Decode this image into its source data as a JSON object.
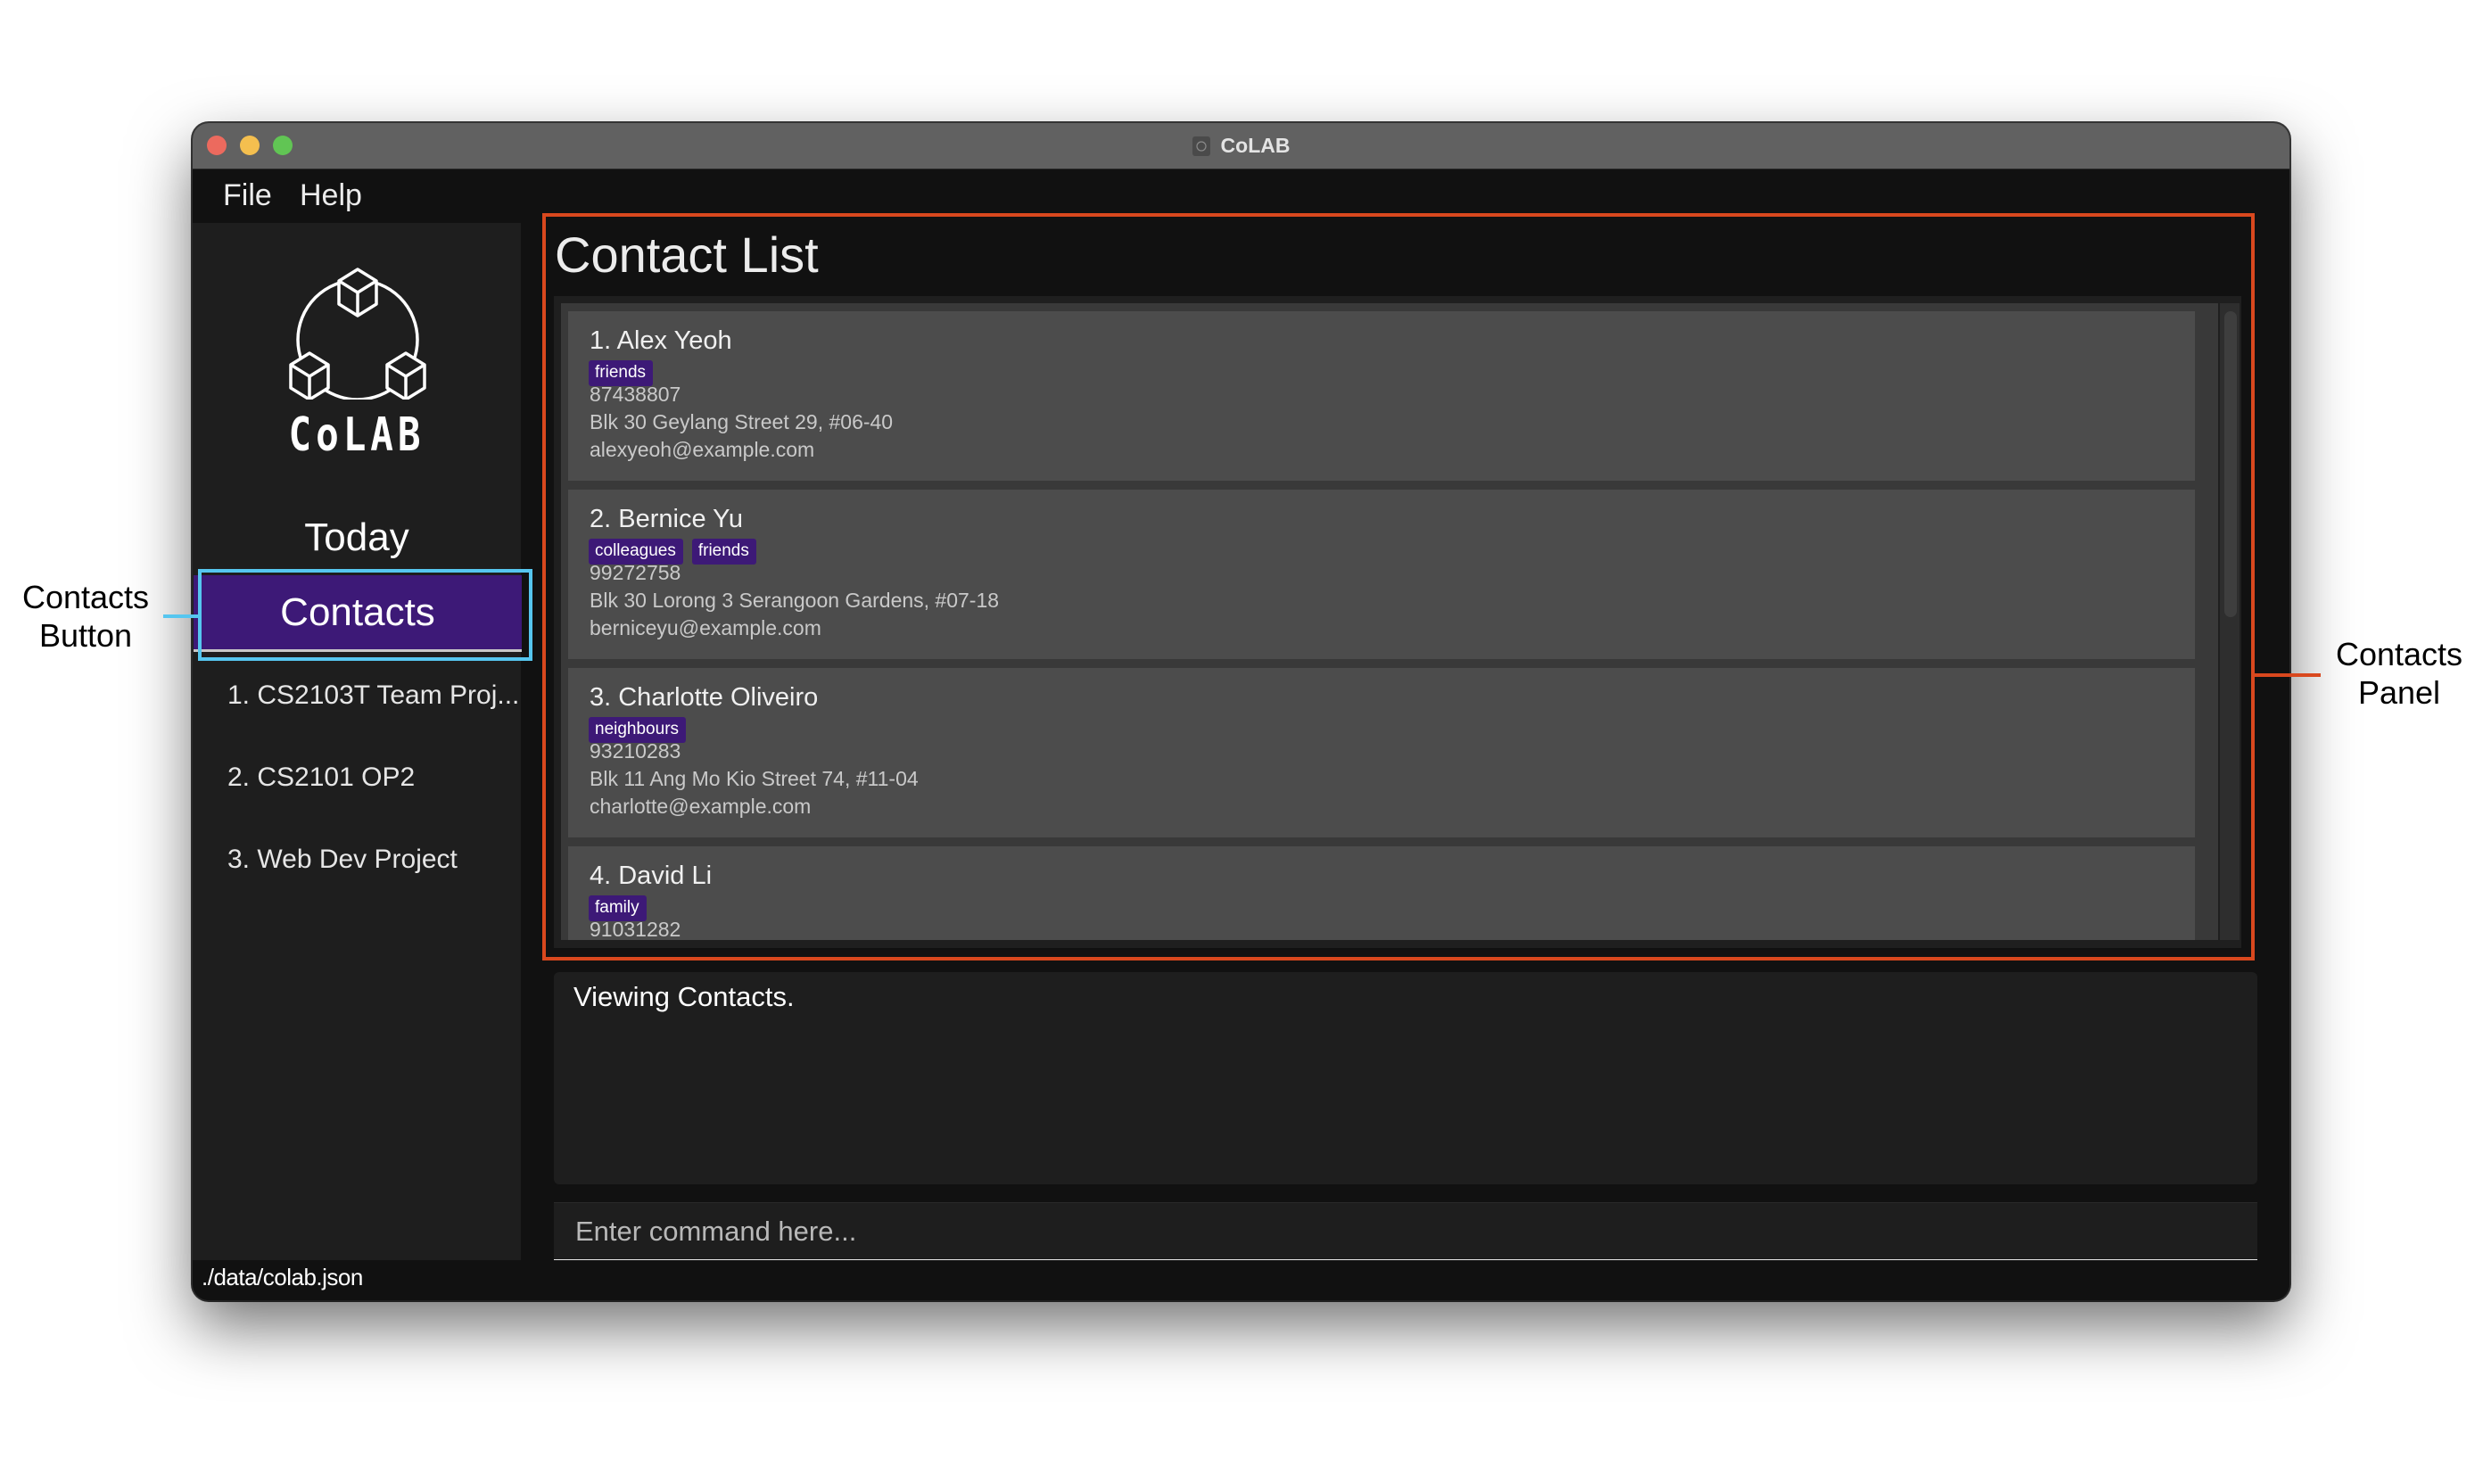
{
  "window": {
    "title": "CoLAB",
    "traffic_lights": [
      {
        "name": "close",
        "color": "#ec6a5e"
      },
      {
        "name": "minimize",
        "color": "#f4bf4f"
      },
      {
        "name": "maximize",
        "color": "#61c554"
      }
    ]
  },
  "menu": {
    "items": [
      {
        "label": "File"
      },
      {
        "label": "Help"
      }
    ]
  },
  "sidebar": {
    "logo_text": "CoLAB",
    "today_label": "Today",
    "contacts_label": "Contacts",
    "projects": [
      {
        "label": "1.  CS2103T Team Proj..."
      },
      {
        "label": "2.  CS2101 OP2"
      },
      {
        "label": "3.  Web Dev Project"
      }
    ]
  },
  "contacts_panel": {
    "title": "Contact List",
    "contacts": [
      {
        "name": "1.  Alex Yeoh",
        "tags": [
          "friends"
        ],
        "phone": "87438807",
        "address": "Blk 30 Geylang Street 29, #06-40",
        "email": "alexyeoh@example.com"
      },
      {
        "name": "2.  Bernice Yu",
        "tags": [
          "colleagues",
          "friends"
        ],
        "phone": "99272758",
        "address": "Blk 30 Lorong 3 Serangoon Gardens, #07-18",
        "email": "berniceyu@example.com"
      },
      {
        "name": "3.  Charlotte Oliveiro",
        "tags": [
          "neighbours"
        ],
        "phone": "93210283",
        "address": "Blk 11 Ang Mo Kio Street 74, #11-04",
        "email": "charlotte@example.com"
      },
      {
        "name": "4.  David Li",
        "tags": [
          "family"
        ],
        "phone": "91031282",
        "address": "",
        "email": ""
      }
    ]
  },
  "result": {
    "text": "Viewing Contacts."
  },
  "command": {
    "value": "",
    "placeholder": "Enter command here..."
  },
  "status_bar": {
    "path": "./data/colab.json"
  },
  "annotations": {
    "contacts_button": {
      "line1": "Contacts",
      "line2": "Button",
      "color": "#56c6ef"
    },
    "contacts_panel": {
      "line1": "Contacts",
      "line2": "Panel",
      "color": "#d9481e"
    }
  },
  "colors": {
    "accent_purple": "#3d1977",
    "window_bg": "#111111",
    "panel_bg": "#1e1e1e",
    "card_bg": "#4c4c4c"
  }
}
